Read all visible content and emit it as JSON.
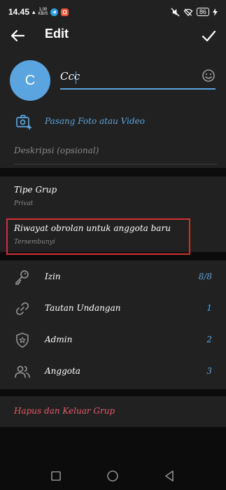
{
  "status_bar": {
    "time": "14.45",
    "net_speed": "1,00",
    "net_unit": "KB/S",
    "battery": "86"
  },
  "app_bar": {
    "title": "Edit"
  },
  "group": {
    "avatar_letter": "C",
    "name_value": "Ccc",
    "set_photo_label": "Pasang Foto atau Video",
    "description_placeholder": "Deskripsi (opsional)"
  },
  "settings": [
    {
      "title": "Tipe Grup",
      "value": "Privat"
    },
    {
      "title": "Riwayat obrolan untuk anggota baru",
      "value": "Tersembunyi"
    }
  ],
  "options": [
    {
      "label": "Izin",
      "count": "8/8",
      "icon": "key-icon"
    },
    {
      "label": "Tautan Undangan",
      "count": "1",
      "icon": "link-icon"
    },
    {
      "label": "Admin",
      "count": "2",
      "icon": "shield-icon"
    },
    {
      "label": "Anggota",
      "count": "3",
      "icon": "people-icon"
    }
  ],
  "danger": {
    "label": "Hapus dan Keluar Grup"
  },
  "colors": {
    "accent": "#5aa4e0",
    "danger": "#e35d68",
    "highlight": "#d32f2f"
  }
}
